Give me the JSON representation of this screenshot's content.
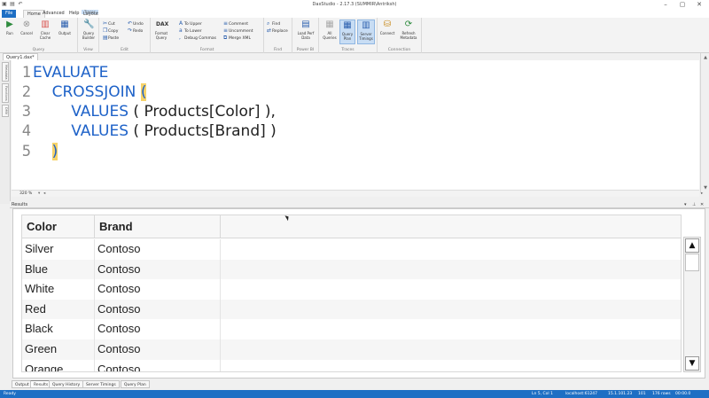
{
  "window": {
    "title": "DaxStudio - 2.17.3 (SUMMIR\\Antriksh)",
    "controls": [
      "minimize-icon",
      "maximize-icon",
      "close-icon"
    ]
  },
  "tabs": {
    "file": "File",
    "home": "Home",
    "advanced": "Advanced",
    "help": "Help",
    "context_group": "Traces",
    "layout": "Layout"
  },
  "ribbon": {
    "query": {
      "label": "Query",
      "run": "Run",
      "cancel": "Cancel",
      "clear_cache": "Clear Cache",
      "output": "Output"
    },
    "view": {
      "label": "View",
      "query_builder": "Query Builder"
    },
    "edit": {
      "label": "Edit",
      "cut": "Cut",
      "copy": "Copy",
      "paste": "Paste",
      "undo": "Undo",
      "redo": "Redo"
    },
    "format": {
      "label": "Format",
      "format_query": "Format Query",
      "to_upper": "To Upper",
      "to_lower": "To Lower",
      "debug_commas": "Debug Commas",
      "comment": "Comment",
      "uncomment": "Uncomment",
      "merge_xml": "Merge XML"
    },
    "find": {
      "label": "Find",
      "find": "Find",
      "replace": "Replace"
    },
    "power_bi": {
      "label": "Power BI",
      "load_perf_data": "Load Perf Data"
    },
    "traces": {
      "label": "Traces",
      "all_queries": "All Queries",
      "query_plan": "Query Plan",
      "server_timings": "Server Timings"
    },
    "connection": {
      "label": "Connection",
      "connect": "Connect",
      "refresh_metadata": "Refresh Metadata"
    }
  },
  "document_tab": "Query1.dax*",
  "left_panels": [
    "Metadata",
    "Functions",
    "DMV"
  ],
  "editor": {
    "lines": [
      {
        "num": "1",
        "indent": "",
        "parts": [
          {
            "t": "EVALUATE",
            "k": "kw"
          }
        ]
      },
      {
        "num": "2",
        "indent": "    ",
        "parts": [
          {
            "t": "CROSSJOIN",
            "k": "kw"
          },
          {
            "t": " ",
            "k": ""
          },
          {
            "t": "(",
            "k": "hl"
          }
        ]
      },
      {
        "num": "3",
        "indent": "        ",
        "parts": [
          {
            "t": "VALUES",
            "k": "kw"
          },
          {
            "t": " ( Products[Color] ),",
            "k": ""
          }
        ]
      },
      {
        "num": "4",
        "indent": "        ",
        "parts": [
          {
            "t": "VALUES",
            "k": "kw"
          },
          {
            "t": " ( Products[Brand] )",
            "k": ""
          }
        ]
      },
      {
        "num": "5",
        "indent": "    ",
        "parts": [
          {
            "t": ")",
            "k": "hl"
          }
        ]
      }
    ],
    "zoom": "320 %"
  },
  "results": {
    "label": "Results",
    "columns": [
      "Color",
      "Brand"
    ],
    "rows": [
      [
        "Silver",
        "Contoso"
      ],
      [
        "Blue",
        "Contoso"
      ],
      [
        "White",
        "Contoso"
      ],
      [
        "Red",
        "Contoso"
      ],
      [
        "Black",
        "Contoso"
      ],
      [
        "Green",
        "Contoso"
      ],
      [
        "Orange",
        "Contoso"
      ]
    ]
  },
  "bottom_tabs": [
    "Output",
    "Results",
    "Query History",
    "Server Timings",
    "Query Plan"
  ],
  "bottom_tabs_active": "Results",
  "status": {
    "ready": "Ready",
    "position": "Ln 5, Col 1",
    "server": "localhost:61247",
    "version": "15.1.101.23",
    "spid": "101",
    "rows": "176 rows",
    "timer": "00:00.0"
  },
  "colors": {
    "accent": "#1e6fc4",
    "keyword": "#1e62c8",
    "brace_highlight": "#f6d36a"
  }
}
